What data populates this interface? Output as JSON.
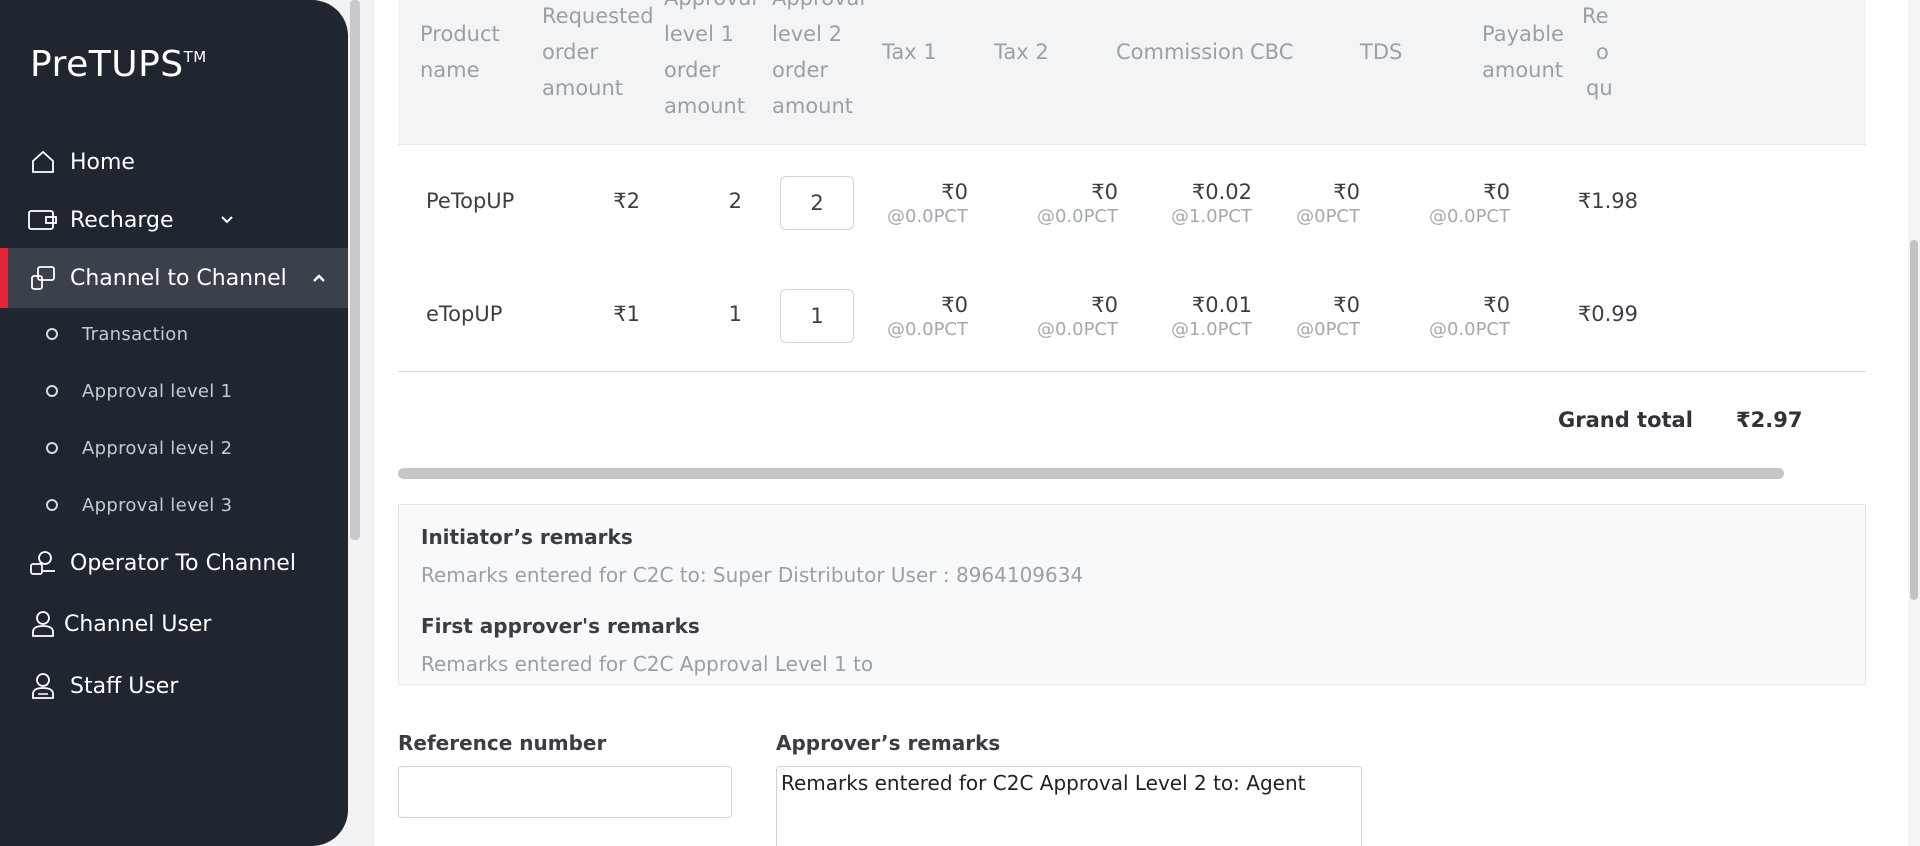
{
  "sidebar": {
    "brand": "PreTUPS",
    "brand_tm": "TM",
    "items": [
      {
        "label": "Home",
        "icon": "home-icon"
      },
      {
        "label": "Recharge",
        "icon": "recharge-icon"
      },
      {
        "label": "Channel to Channel",
        "icon": "channel-transfer-icon"
      },
      {
        "label": "Operator To Channel",
        "icon": "operator-icon"
      },
      {
        "label": "Channel User",
        "icon": "user-icon"
      },
      {
        "label": "Staff User",
        "icon": "staff-icon"
      }
    ],
    "sub_items": [
      "Transaction",
      "Approval level 1",
      "Approval level 2",
      "Approval level 3"
    ]
  },
  "table": {
    "headers": {
      "product": [
        "Product",
        "name"
      ],
      "requested": [
        "Requested",
        "order",
        "amount"
      ],
      "approval1": [
        "Approval",
        "level 1",
        "order",
        "amount"
      ],
      "approval2": [
        "Approval",
        "level 2",
        "order",
        "amount"
      ],
      "tax1": "Tax 1",
      "tax2": "Tax 2",
      "commission": "Commission",
      "cbc": "CBC",
      "tds": "TDS",
      "payable": [
        "Payable",
        "amount"
      ],
      "extra": [
        "Re",
        "o",
        "qu"
      ]
    },
    "rows": [
      {
        "product": "PeTopUP",
        "requested": "₹2",
        "approval1": "2",
        "approval2": "2",
        "tax1": "₹0",
        "tax1_rate": "@0.0PCT",
        "tax2": "₹0",
        "tax2_rate": "@0.0PCT",
        "commission": "₹0.02",
        "commission_rate": "@1.0PCT",
        "cbc": "₹0",
        "cbc_rate": "@0PCT",
        "tds": "₹0",
        "tds_rate": "@0.0PCT",
        "payable": "₹1.98"
      },
      {
        "product": "eTopUP",
        "requested": "₹1",
        "approval1": "1",
        "approval2": "1",
        "tax1": "₹0",
        "tax1_rate": "@0.0PCT",
        "tax2": "₹0",
        "tax2_rate": "@0.0PCT",
        "commission": "₹0.01",
        "commission_rate": "@1.0PCT",
        "cbc": "₹0",
        "cbc_rate": "@0PCT",
        "tds": "₹0",
        "tds_rate": "@0.0PCT",
        "payable": "₹0.99"
      }
    ],
    "grand_total_label": "Grand total",
    "grand_total_value": "₹2.97"
  },
  "remarks": {
    "initiator_title": "Initiator’s remarks",
    "initiator_text": "Remarks entered for C2C to: Super Distributor User : 8964109634",
    "first_title": "First approver's remarks",
    "first_text": "Remarks entered for C2C Approval Level 1 to"
  },
  "form": {
    "reference_label": "Reference number",
    "reference_value": "",
    "approver_label": "Approver’s remarks",
    "approver_value": "Remarks entered for C2C Approval Level 2 to: Agent"
  },
  "colors": {
    "sidebar_bg": "#1f2630",
    "active_accent": "#e5263a",
    "active_bg": "#3a414a"
  }
}
